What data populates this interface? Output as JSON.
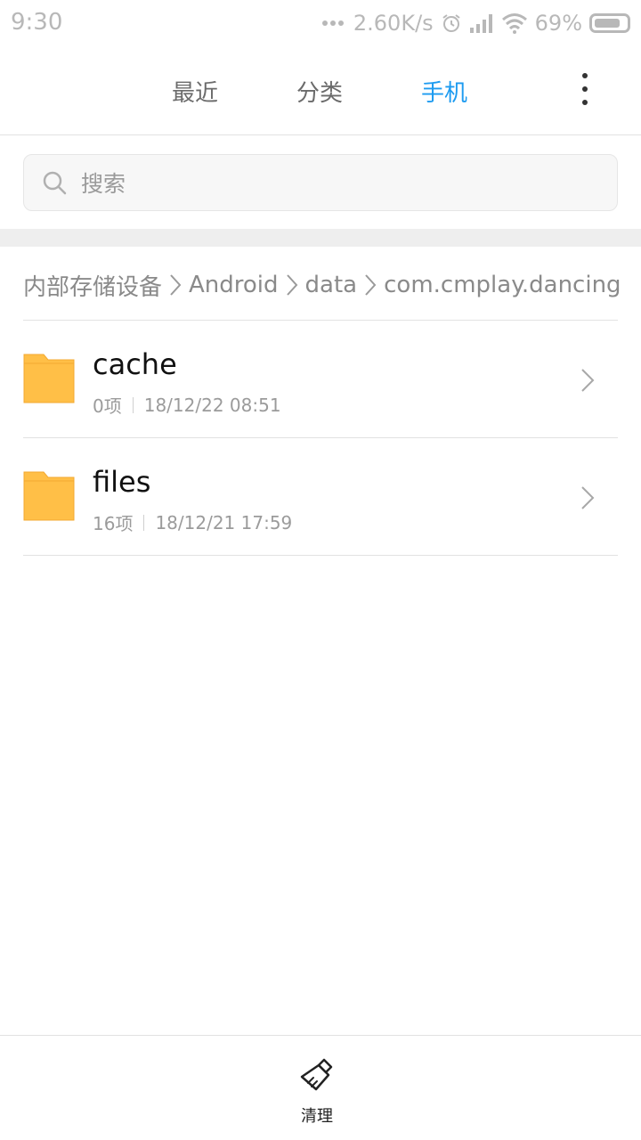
{
  "status_bar": {
    "time": "9:30",
    "speed": "2.60K/s",
    "battery": "69%"
  },
  "tabs": [
    {
      "label": "最近",
      "active": false
    },
    {
      "label": "分类",
      "active": false
    },
    {
      "label": "手机",
      "active": true
    }
  ],
  "search": {
    "placeholder": "搜索"
  },
  "breadcrumb": [
    "内部存储设备",
    "Android",
    "data",
    "com.cmplay.dancing"
  ],
  "files": [
    {
      "name": "cache",
      "count": "0项",
      "date": "18/12/22 08:51"
    },
    {
      "name": "files",
      "count": "16项",
      "date": "18/12/21 17:59"
    }
  ],
  "bottom": {
    "clean_label": "清理"
  },
  "colors": {
    "accent": "#1d9bf0",
    "folder": "#ffbf47",
    "folder_dark": "#f3a930"
  }
}
